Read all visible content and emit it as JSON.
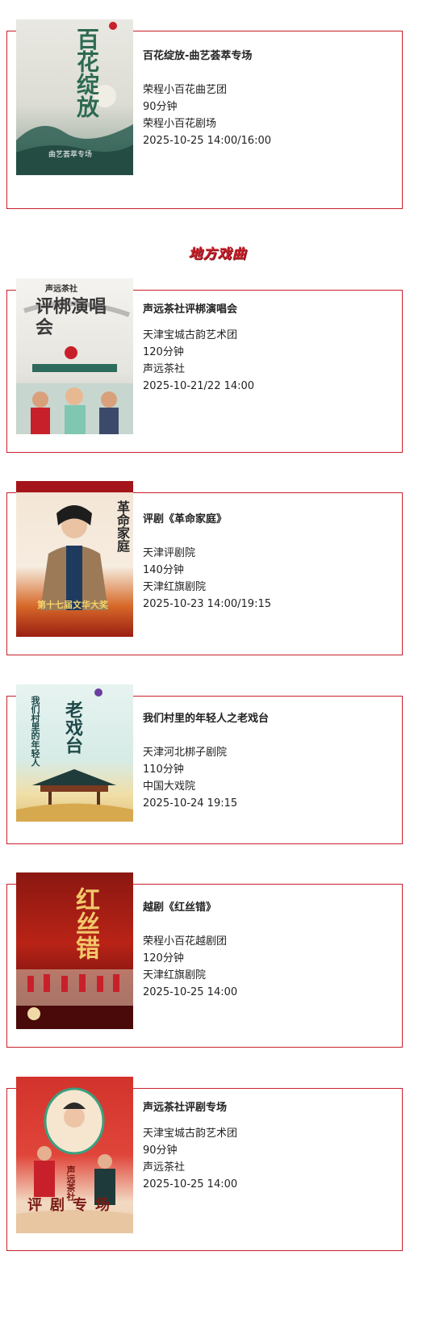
{
  "section_title": "地方戏曲",
  "colors": {
    "accent": "#c8202a"
  },
  "events": [
    {
      "title": "百花绽放-曲艺荟萃专场",
      "troupe": "荣程小百花曲艺团",
      "duration": "90分钟",
      "venue": "荣程小百花剧场",
      "time": "2025-10-25  14:00/16:00",
      "poster": {
        "main": "百花绽放",
        "sub": "曲艺荟萃专场",
        "theme": "ink-green"
      }
    },
    {
      "title": "声远茶社评梆演唱会",
      "troupe": "天津宝城古韵艺术团",
      "duration": "120分钟",
      "venue": "声远茶社",
      "time": "2025-10-21/22 14:00",
      "poster": {
        "main": "评梆演唱会",
        "sub": "声远茶社",
        "theme": "ink-grey"
      }
    },
    {
      "title": "评剧《革命家庭》",
      "troupe": "天津评剧院",
      "duration": "140分钟",
      "venue": "天津红旗剧院",
      "time": "2025-10-23 14:00/19:15",
      "poster": {
        "main": "革命家庭",
        "sub": "第十七届文华大奖",
        "theme": "red"
      }
    },
    {
      "title": "我们村里的年轻人之老戏台",
      "troupe": "天津河北梆子剧院",
      "duration": "110分钟",
      "venue": "中国大戏院",
      "time": "2025-10-24 19:15",
      "poster": {
        "main": "老戏台",
        "sub": "我们村里的年轻人",
        "theme": "teal"
      }
    },
    {
      "title": "越剧《红丝错》",
      "troupe": "荣程小百花越剧团",
      "duration": "120分钟",
      "venue": "天津红旗剧院",
      "time": "2025-10-25 14:00",
      "poster": {
        "main": "红丝错",
        "sub": "",
        "theme": "dark-red"
      }
    },
    {
      "title": "声远茶社评剧专场",
      "troupe": "天津宝城古韵艺术团",
      "duration": "90分钟",
      "venue": "声远茶社",
      "time": "2025-10-25 14:00",
      "poster": {
        "main": "评剧专场",
        "sub": "声远茶社",
        "theme": "bright-red"
      }
    }
  ]
}
